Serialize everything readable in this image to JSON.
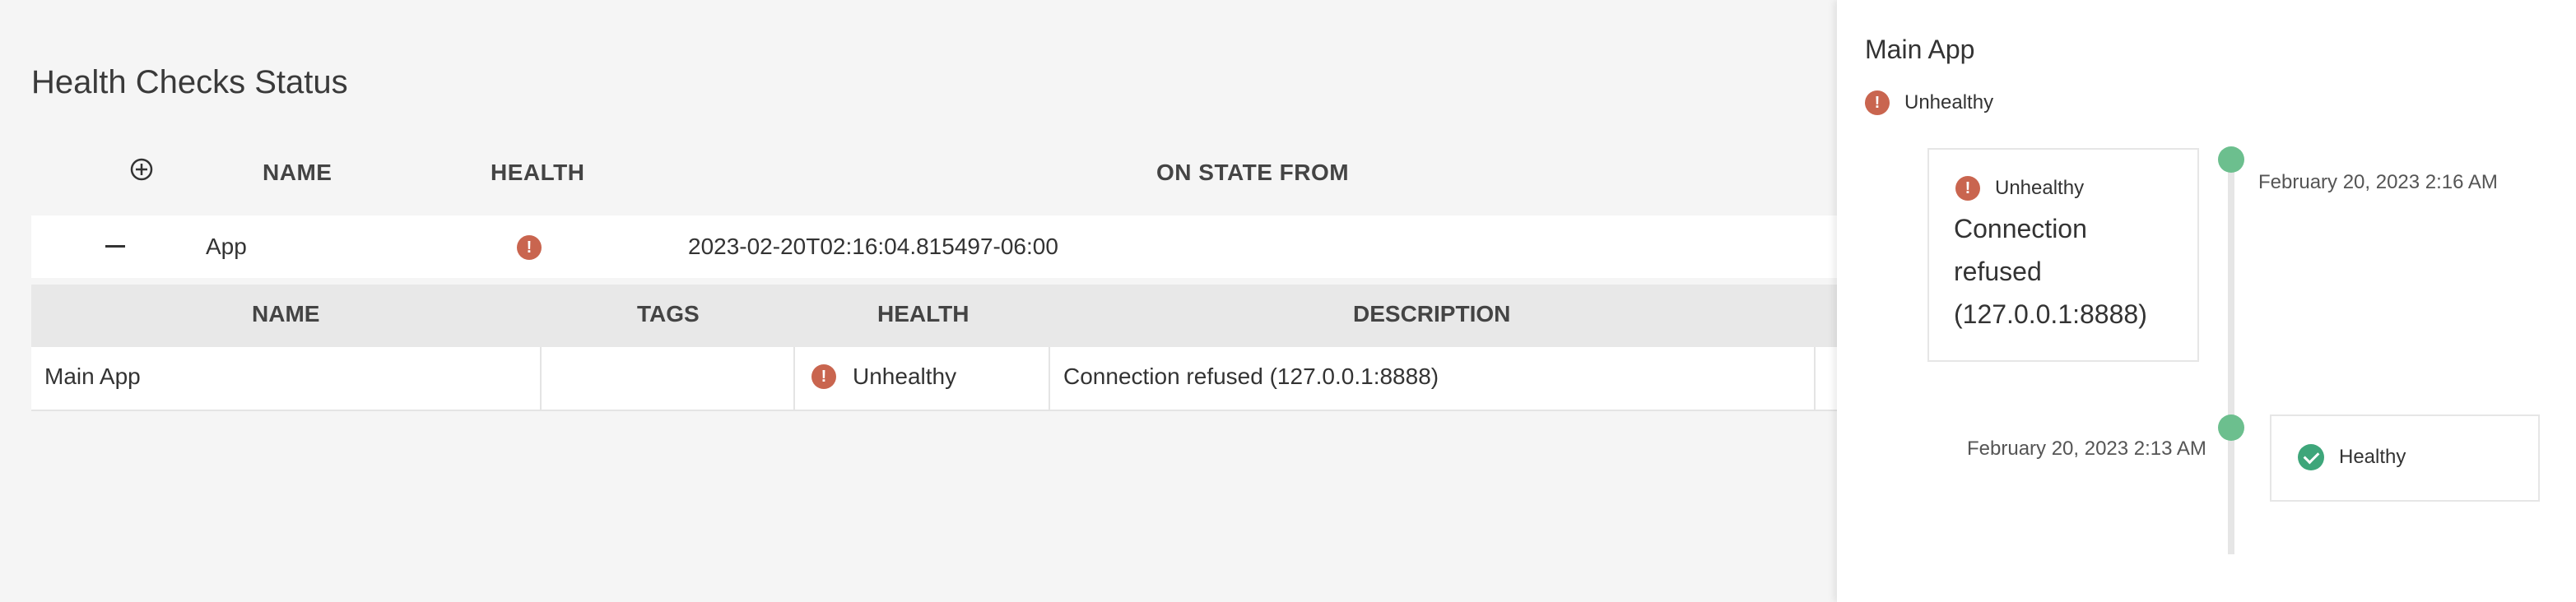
{
  "page": {
    "title": "Health Checks Status"
  },
  "main_table": {
    "headers": {
      "name": "NAME",
      "health": "HEALTH",
      "on_state_from": "ON STATE FROM"
    },
    "rows": [
      {
        "name": "App",
        "on_state_from": "2023-02-20T02:16:04.815497-06:00"
      }
    ]
  },
  "sub_table": {
    "headers": {
      "name": "NAME",
      "tags": "TAGS",
      "health": "HEALTH",
      "description": "DESCRIPTION"
    },
    "rows": [
      {
        "name": "Main App",
        "tags": "",
        "health": "Unhealthy",
        "description": "Connection refused (127.0.0.1:8888)"
      }
    ]
  },
  "panel": {
    "title": "Main App",
    "status": "Unhealthy",
    "timeline": [
      {
        "status": "Unhealthy",
        "description": "Connection refused (127.0.0.1:8888)",
        "date": "February 20, 2023 2:16 AM"
      },
      {
        "status": "Healthy",
        "description": "",
        "date": "February 20, 2023 2:13 AM"
      }
    ]
  },
  "icons": {
    "error": "!",
    "error_color": "#c9654f",
    "healthy_color": "#3ea67a",
    "timeline_dot_color": "#6cbf8e"
  }
}
